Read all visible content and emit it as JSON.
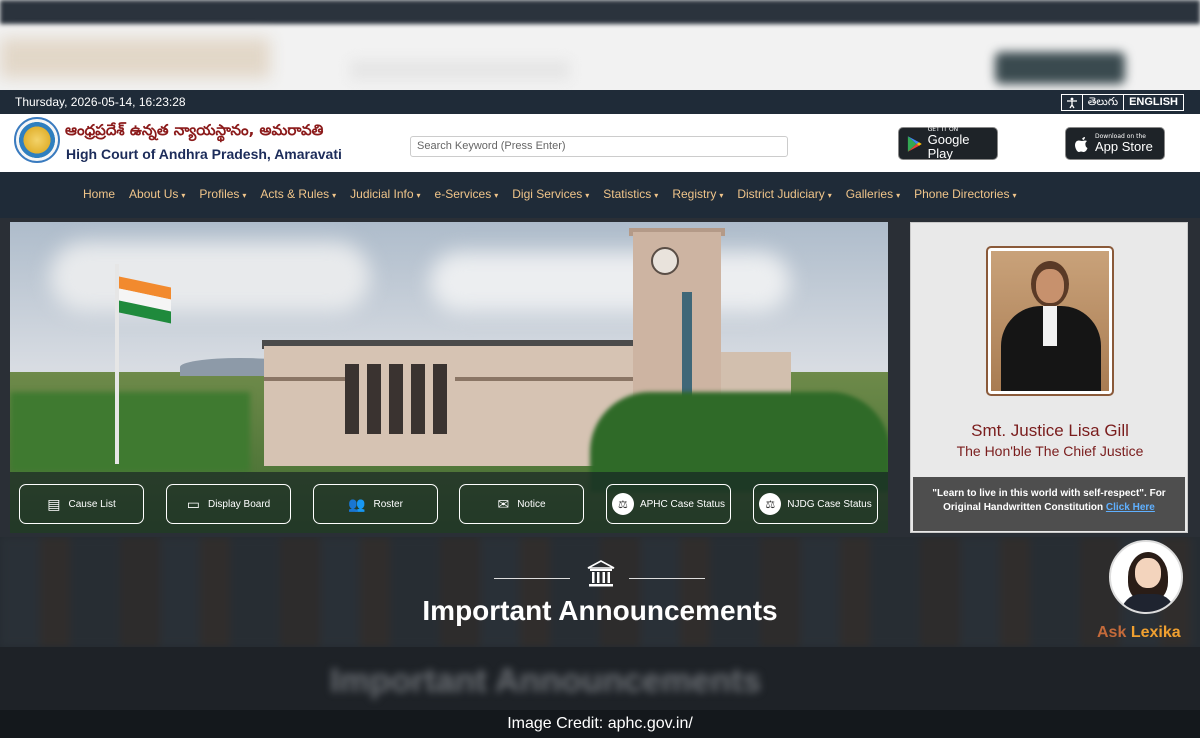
{
  "infobar": {
    "datetime": "Thursday, 2026-05-14, 16:23:28",
    "languages": [
      "తెలుగు",
      "ENGLISH"
    ]
  },
  "header": {
    "title_telugu": "ఆంధ్రప్రదేశ్ ఉన్నత న్యాయస్థానం, అమరావతి",
    "title_english": "High Court of Andhra Pradesh, Amaravati",
    "search_placeholder": "Search Keyword (Press Enter)",
    "google_play": {
      "small": "GET IT ON",
      "big": "Google Play"
    },
    "app_store": {
      "small": "Download on the",
      "big": "App Store"
    }
  },
  "nav": {
    "items": [
      {
        "label": "Home",
        "caret": ""
      },
      {
        "label": "About Us",
        "caret": "▾"
      },
      {
        "label": "Profiles",
        "caret": "▾"
      },
      {
        "label": "Acts & Rules",
        "caret": "▾"
      },
      {
        "label": "Judicial Info",
        "caret": "▾"
      },
      {
        "label": "e-Services",
        "caret": "▾"
      },
      {
        "label": "Digi Services",
        "caret": "▾"
      },
      {
        "label": "Statistics",
        "caret": "▾"
      },
      {
        "label": "Registry",
        "caret": "▾"
      },
      {
        "label": "District Judiciary",
        "caret": "▾"
      },
      {
        "label": "Galleries",
        "caret": "▾"
      },
      {
        "label": "Phone Directories",
        "caret": "▾"
      }
    ]
  },
  "quicklinks": [
    {
      "label": "Cause List",
      "icon": "document-icon"
    },
    {
      "label": "Display Board",
      "icon": "monitor-icon"
    },
    {
      "label": "Roster",
      "icon": "people-icon"
    },
    {
      "label": "Notice",
      "icon": "envelope-icon"
    },
    {
      "label": "APHC Case Status",
      "icon": "scales-icon"
    },
    {
      "label": "NJDG Case Status",
      "icon": "scales-icon"
    }
  ],
  "chief_justice": {
    "name": "Smt. Justice Lisa Gill",
    "title": "The Hon'ble The Chief Justice",
    "quote": "\"Learn to live in this world with self-respect\". For Original Handwritten Constitution",
    "link": "Click Here"
  },
  "announcements": {
    "title": "Important Announcements",
    "blurred_title": "Important Announcements"
  },
  "lexika": {
    "ask": "Ask",
    "name": "Lexika"
  },
  "credit": "Image Credit: aphc.gov.in/"
}
